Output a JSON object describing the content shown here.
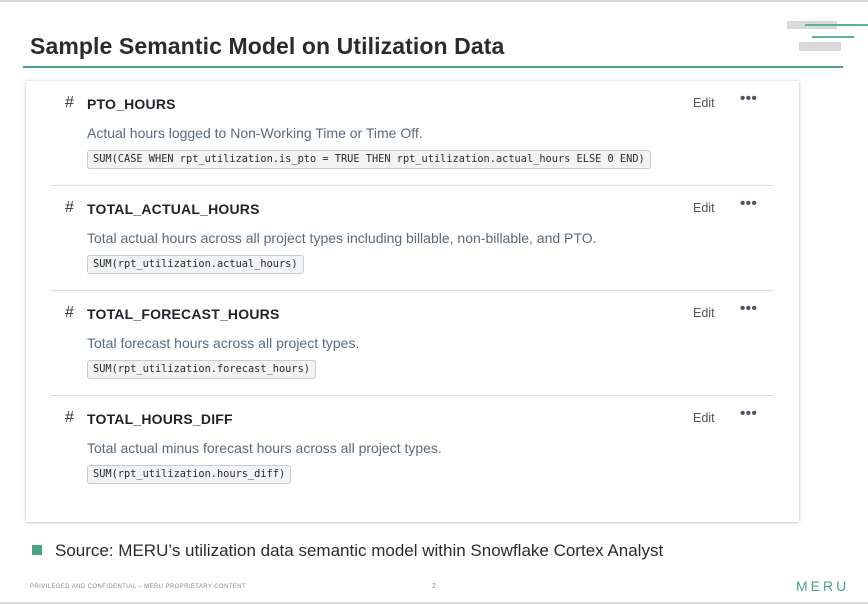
{
  "title": "Sample Semantic Model on Utilization Data",
  "accent_color": "#4aa37e",
  "metrics": [
    {
      "icon": "hash-icon",
      "name": "PTO_HOURS",
      "edit_label": "Edit",
      "more_label": "•••",
      "description": "Actual hours logged to Non-Working Time or Time Off.",
      "expression": "SUM(CASE WHEN rpt_utilization.is_pto = TRUE THEN rpt_utilization.actual_hours ELSE 0 END)"
    },
    {
      "icon": "hash-icon",
      "name": "TOTAL_ACTUAL_HOURS",
      "edit_label": "Edit",
      "more_label": "•••",
      "description": "Total actual hours across all project types including billable, non-billable, and PTO.",
      "expression": "SUM(rpt_utilization.actual_hours)"
    },
    {
      "icon": "hash-icon",
      "name": "TOTAL_FORECAST_HOURS",
      "edit_label": "Edit",
      "more_label": "•••",
      "description": "Total forecast hours across all project types.",
      "expression": "SUM(rpt_utilization.forecast_hours)"
    },
    {
      "icon": "hash-icon",
      "name": "TOTAL_HOURS_DIFF",
      "edit_label": "Edit",
      "more_label": "•••",
      "description": "Total actual minus forecast hours across all project types.",
      "expression": "SUM(rpt_utilization.hours_diff)"
    }
  ],
  "source": "Source: MERU’s utilization data semantic model within Snowflake Cortex Analyst",
  "footer": {
    "confidential": "PRIVILEGED AND CONFIDENTIAL – MERU PROPRIETARY CONTENT",
    "page_number": "2",
    "logo": "MERU"
  }
}
